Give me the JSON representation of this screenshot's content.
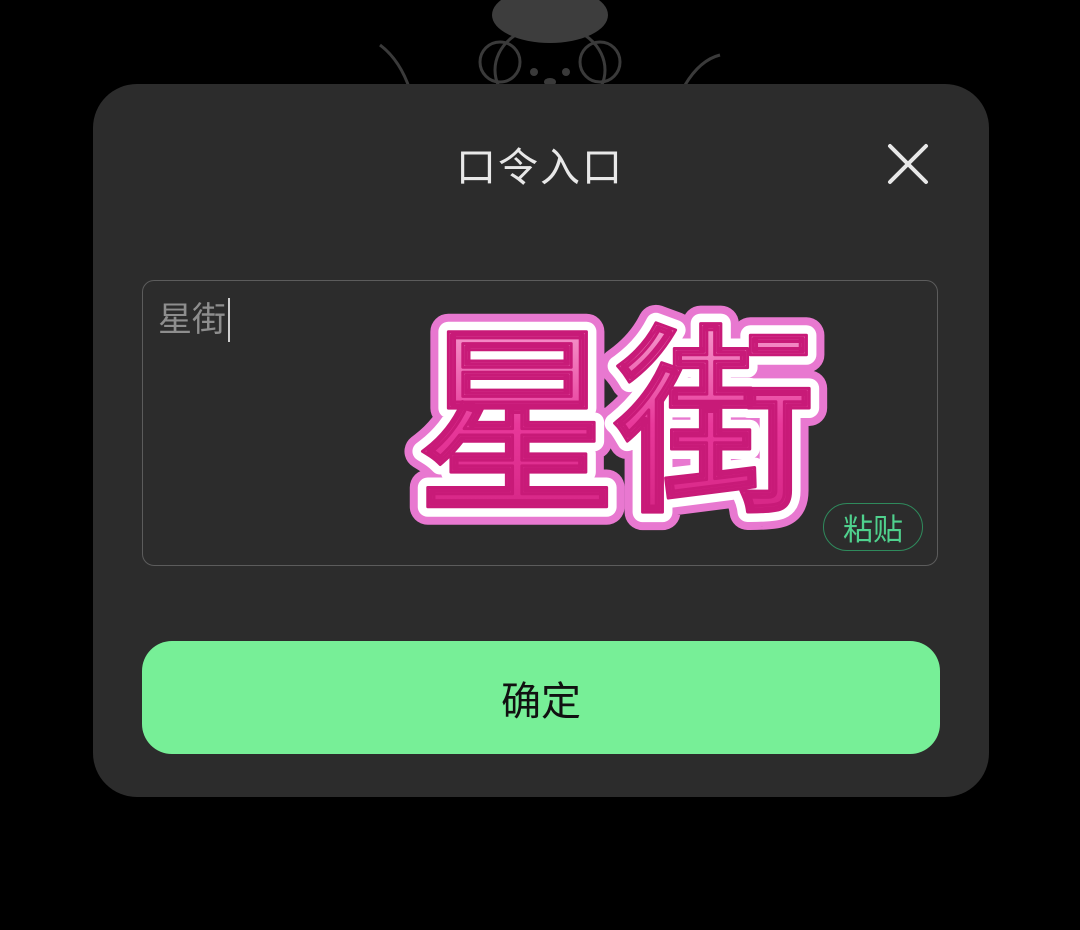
{
  "dialog": {
    "title": "口令入口",
    "close_icon": "close-icon"
  },
  "input": {
    "value": "星街",
    "overlay_text": "星街",
    "paste_label": "粘贴"
  },
  "confirm_label": "确定",
  "colors": {
    "dialog_bg": "#2c2c2c",
    "accent_green": "#77ef97",
    "paste_green": "#4fd18d",
    "overlay_pink": "#e8389a"
  }
}
